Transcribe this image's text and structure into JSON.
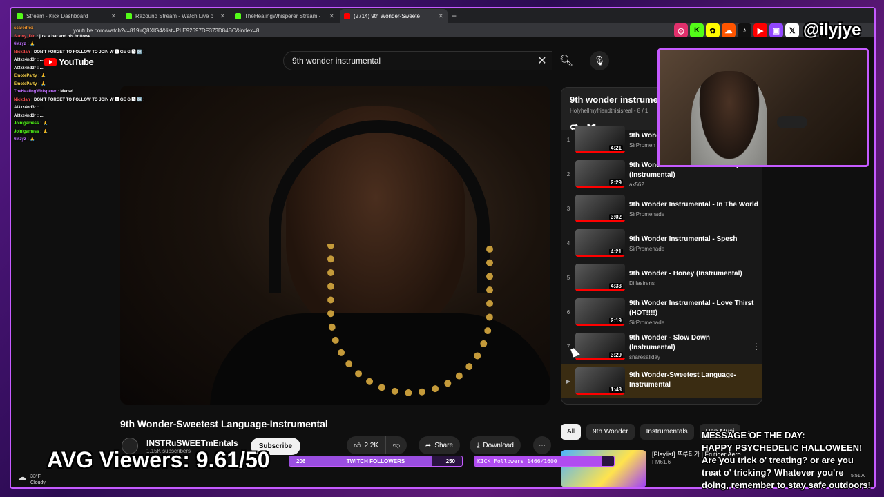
{
  "browser": {
    "tabs": [
      {
        "title": "Stream - Kick Dashboard",
        "color": "#53fc18"
      },
      {
        "title": "Razound Stream - Watch Live o",
        "color": "#53fc18"
      },
      {
        "title": "TheHealingWhisperer Stream -",
        "color": "#53fc18"
      },
      {
        "title": "(2714) 9th Wonder-Sweete",
        "color": "#ff0000",
        "active": true
      }
    ],
    "url": "youtube.com/watch?v=819lrQ8XIG4&list=PLE92697DF373D84BC&index=8"
  },
  "youtube": {
    "logo": "YouTube",
    "search_value": "9th wonder instrumental",
    "video_title": "9th Wonder-Sweetest Language-Instrumental",
    "channel": {
      "name": "INSTRuSWEETmEntals",
      "subs": "1.15K subscribers"
    },
    "subscribe_label": "Subscribe",
    "likes": "2.2K",
    "share_label": "Share",
    "download_label": "Download",
    "playlist": {
      "title": "9th wonder instrume",
      "subtitle": "Holyhellmyfriendthisisreal - 8 / 1",
      "items": [
        {
          "n": "1",
          "title": "9th Wond Glimmer",
          "channel": "SirPromen",
          "dur": "4:21"
        },
        {
          "n": "2",
          "title": "9th Wonder - The Beautiful Decay (Instrumental)",
          "channel": "ak562",
          "dur": "2:29"
        },
        {
          "n": "3",
          "title": "9th Wonder Instrumental - In The World",
          "channel": "SirPromenade",
          "dur": "3:02"
        },
        {
          "n": "4",
          "title": "9th Wonder Instrumental - Spesh",
          "channel": "SirPromenade",
          "dur": "4:21"
        },
        {
          "n": "5",
          "title": "9th Wonder - Honey (Instrumental)",
          "channel": "Dillasirens",
          "dur": "4:33"
        },
        {
          "n": "6",
          "title": "9th Wonder Instrumental - Love Thirst (HOT!!!!)",
          "channel": "SirPromenade",
          "dur": "2:19"
        },
        {
          "n": "7",
          "title": "9th Wonder - Slow Down (Instrumental)",
          "channel": "snaresallday",
          "dur": "3:29"
        },
        {
          "n": "▶",
          "title": "9th Wonder-Sweetest Language-Instrumental",
          "channel": "",
          "dur": "1:48",
          "current": true
        }
      ]
    },
    "chips": [
      "All",
      "9th Wonder",
      "Instrumentals",
      "Pop Musi"
    ],
    "rec": {
      "title": "[Playlist] 프루티가 | Frutiger Aero",
      "channel": "FM61.6"
    }
  },
  "chat": [
    {
      "user": "scaredfox",
      "color": "#ff9d2e",
      "msg": ""
    },
    {
      "user": "Sunny_Did",
      "color": "#ff4f4f",
      "msg": ": just a bar and his bottowe"
    },
    {
      "user": "6Mzyz",
      "color": "#c070ff",
      "msg": ": 🙏"
    },
    {
      "user": "Nickdan",
      "color": "#ff4f4f",
      "msg": ": DON'T FORGET TO FOLLOW TO JOIN W 🅰 GE G 🅰 🆗 !"
    },
    {
      "user": "AI3xz4nd3r",
      "color": "#ffffff",
      "msg": ": ..."
    },
    {
      "user": "AI3xz4nd3r",
      "color": "#ffffff",
      "msg": ": ..."
    },
    {
      "user": "EmoteParty",
      "color": "#ffd84a",
      "msg": ": 🙏"
    },
    {
      "user": "EmoteParty",
      "color": "#ffd84a",
      "msg": ": 🙏"
    },
    {
      "user": "TheHealingWhisperer",
      "color": "#c070ff",
      "msg": ": Meow!"
    },
    {
      "user": "Nickdan",
      "color": "#ff4f4f",
      "msg": ": DON'T FORGET TO FOLLOW TO JOIN W 🅰 GE G 🅰 🆗 !"
    },
    {
      "user": "AI3xz4nd3r",
      "color": "#ffffff",
      "msg": ": ..."
    },
    {
      "user": "AI3xz4nd3r",
      "color": "#ffffff",
      "msg": ": ..."
    },
    {
      "user": "Joinlgamess",
      "color": "#53fc18",
      "msg": ": 🙏"
    },
    {
      "user": "Joinlgamess",
      "color": "#53fc18",
      "msg": ": 🙏"
    },
    {
      "user": "6Mzyz",
      "color": "#c070ff",
      "msg": ": 🙏"
    }
  ],
  "overlay": {
    "handle": "@ilyjye",
    "avg_viewers": "AVG Viewers: 9.61/50",
    "twitch": {
      "current": "206",
      "label": "TWITCH FOLLOWERS",
      "goal": "250",
      "progress": 0.824
    },
    "kick": {
      "label": "KICK Followers 1466/1600",
      "progress": 0.916
    },
    "weather": {
      "temp": "33°F",
      "desc": "Cloudy"
    },
    "motd": [
      "MESSAGE OF THE DAY:",
      "HAPPY PSYCHEDELIC HALLOWEEN!",
      "Are you trick o' treating? or are you",
      "treat o' tricking? Whatever you're",
      "doing, remember to stay safe outdoors!"
    ],
    "clock": "5:51 A"
  }
}
